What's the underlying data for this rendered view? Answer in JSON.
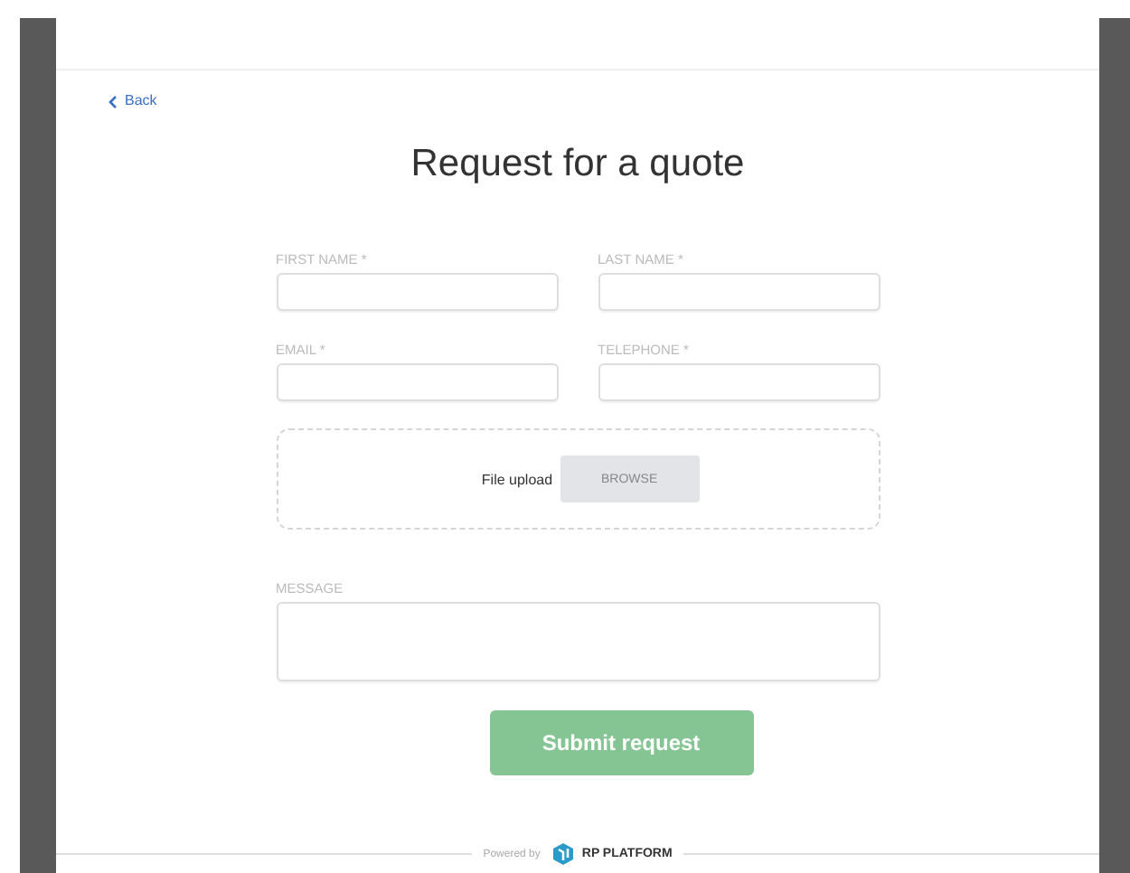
{
  "back_link": {
    "label": "Back"
  },
  "title": "Request for a quote",
  "fields": [
    {
      "label": "FIRST NAME *"
    },
    {
      "label": "LAST NAME *"
    },
    {
      "label": "EMAIL *"
    },
    {
      "label": "TELEPHONE *"
    }
  ],
  "file_upload": {
    "label": "File upload",
    "button": "BROWSE"
  },
  "message": {
    "label": "MESSAGE"
  },
  "submit_button": "Submit request",
  "footer": {
    "powered_by": "Powered by",
    "brand": "RP PLATFORM"
  }
}
